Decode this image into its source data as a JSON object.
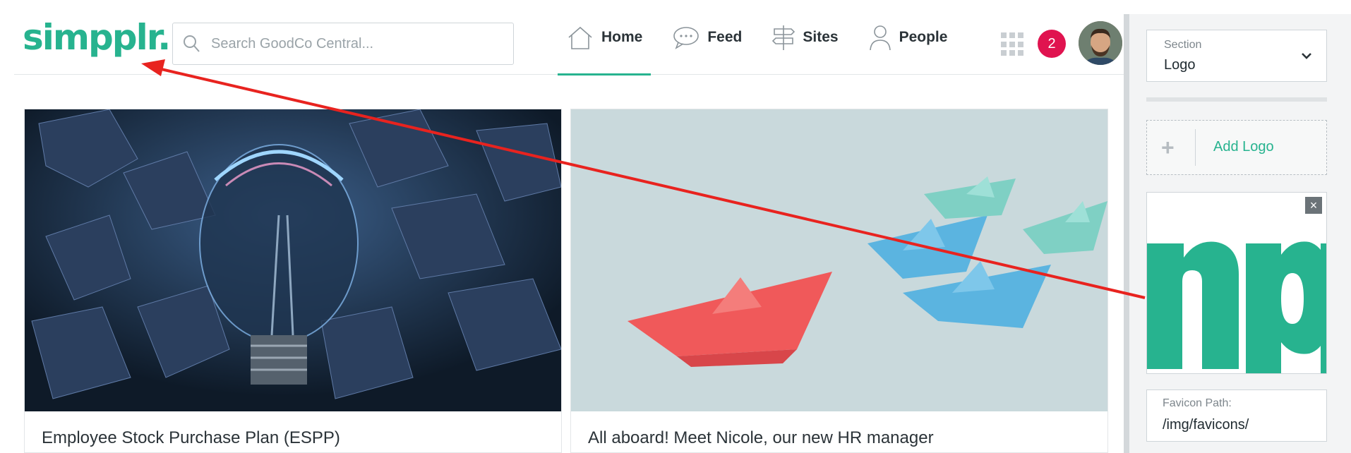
{
  "header": {
    "logo_text": "simpplr.",
    "search_placeholder": "Search GoodCo Central...",
    "nav": [
      {
        "label": "Home",
        "icon": "home-icon",
        "active": true
      },
      {
        "label": "Feed",
        "icon": "chat-bubble-icon",
        "active": false
      },
      {
        "label": "Sites",
        "icon": "signpost-icon",
        "active": false
      },
      {
        "label": "People",
        "icon": "person-icon",
        "active": false
      }
    ],
    "notification_count": "2"
  },
  "cards": [
    {
      "title": "Employee Stock Purchase Plan (ESPP)",
      "image": "lightbulb-crumpled-paper-photo"
    },
    {
      "title": "All aboard! Meet Nicole, our new HR manager",
      "image": "paper-boats-photo"
    }
  ],
  "panel": {
    "section_label": "Section",
    "section_value": "Logo",
    "add_logo_label": "Add Logo",
    "favicon_label": "Favicon Path:",
    "favicon_value": "/img/favicons/",
    "close_symbol": "×",
    "add_symbol": "+"
  },
  "colors": {
    "brand": "#27b38f",
    "badge": "#e0134f",
    "annotation_arrow": "#e8231f"
  }
}
